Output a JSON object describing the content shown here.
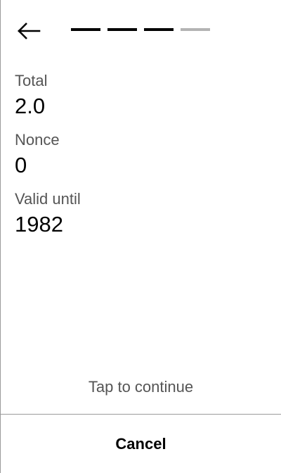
{
  "header": {
    "back_icon": "arrow-left-icon",
    "progress": {
      "total_steps": 4,
      "completed_steps": 3
    }
  },
  "details": {
    "total_label": "Total",
    "total_value": "2.0",
    "nonce_label": "Nonce",
    "nonce_value": "0",
    "valid_until_label": "Valid until",
    "valid_until_value": "1982"
  },
  "footer": {
    "tap_hint": "Tap to continue",
    "cancel_label": "Cancel"
  },
  "colors": {
    "text_primary": "#000000",
    "text_secondary": "#555555",
    "step_active": "#000000",
    "step_inactive": "#b3b3b3",
    "divider": "#9a9a9a"
  }
}
